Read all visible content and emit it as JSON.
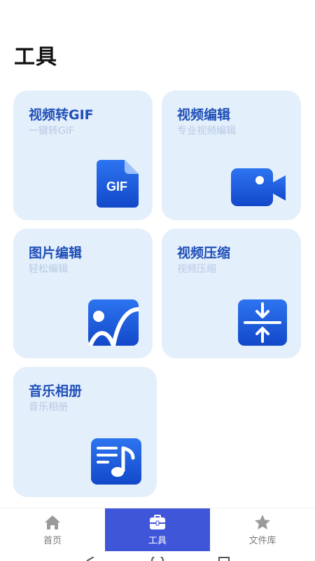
{
  "page": {
    "title": "工具"
  },
  "tools": [
    {
      "title": "视频转GIF",
      "subtitle": "一键转GIF",
      "icon": "gif-file-icon",
      "icon_text": "GIF"
    },
    {
      "title": "视频编辑",
      "subtitle": "专业视频编辑",
      "icon": "video-camera-icon"
    },
    {
      "title": "图片编辑",
      "subtitle": "轻松编辑",
      "icon": "image-icon"
    },
    {
      "title": "视频压缩",
      "subtitle": "视频压缩",
      "icon": "compress-icon"
    },
    {
      "title": "音乐相册",
      "subtitle": "音乐相册",
      "icon": "music-album-icon"
    }
  ],
  "tabbar": {
    "items": [
      {
        "label": "首页",
        "icon": "home-icon",
        "active": false
      },
      {
        "label": "工具",
        "icon": "toolbox-icon",
        "active": true
      },
      {
        "label": "文件库",
        "icon": "star-icon",
        "active": false
      }
    ]
  },
  "colors": {
    "card_bg": "#e4effc",
    "title_blue": "#1f4fb7",
    "subtitle": "#b7c9e4",
    "icon_blue": "#1a5fe0",
    "tab_active": "#3f56d9"
  }
}
